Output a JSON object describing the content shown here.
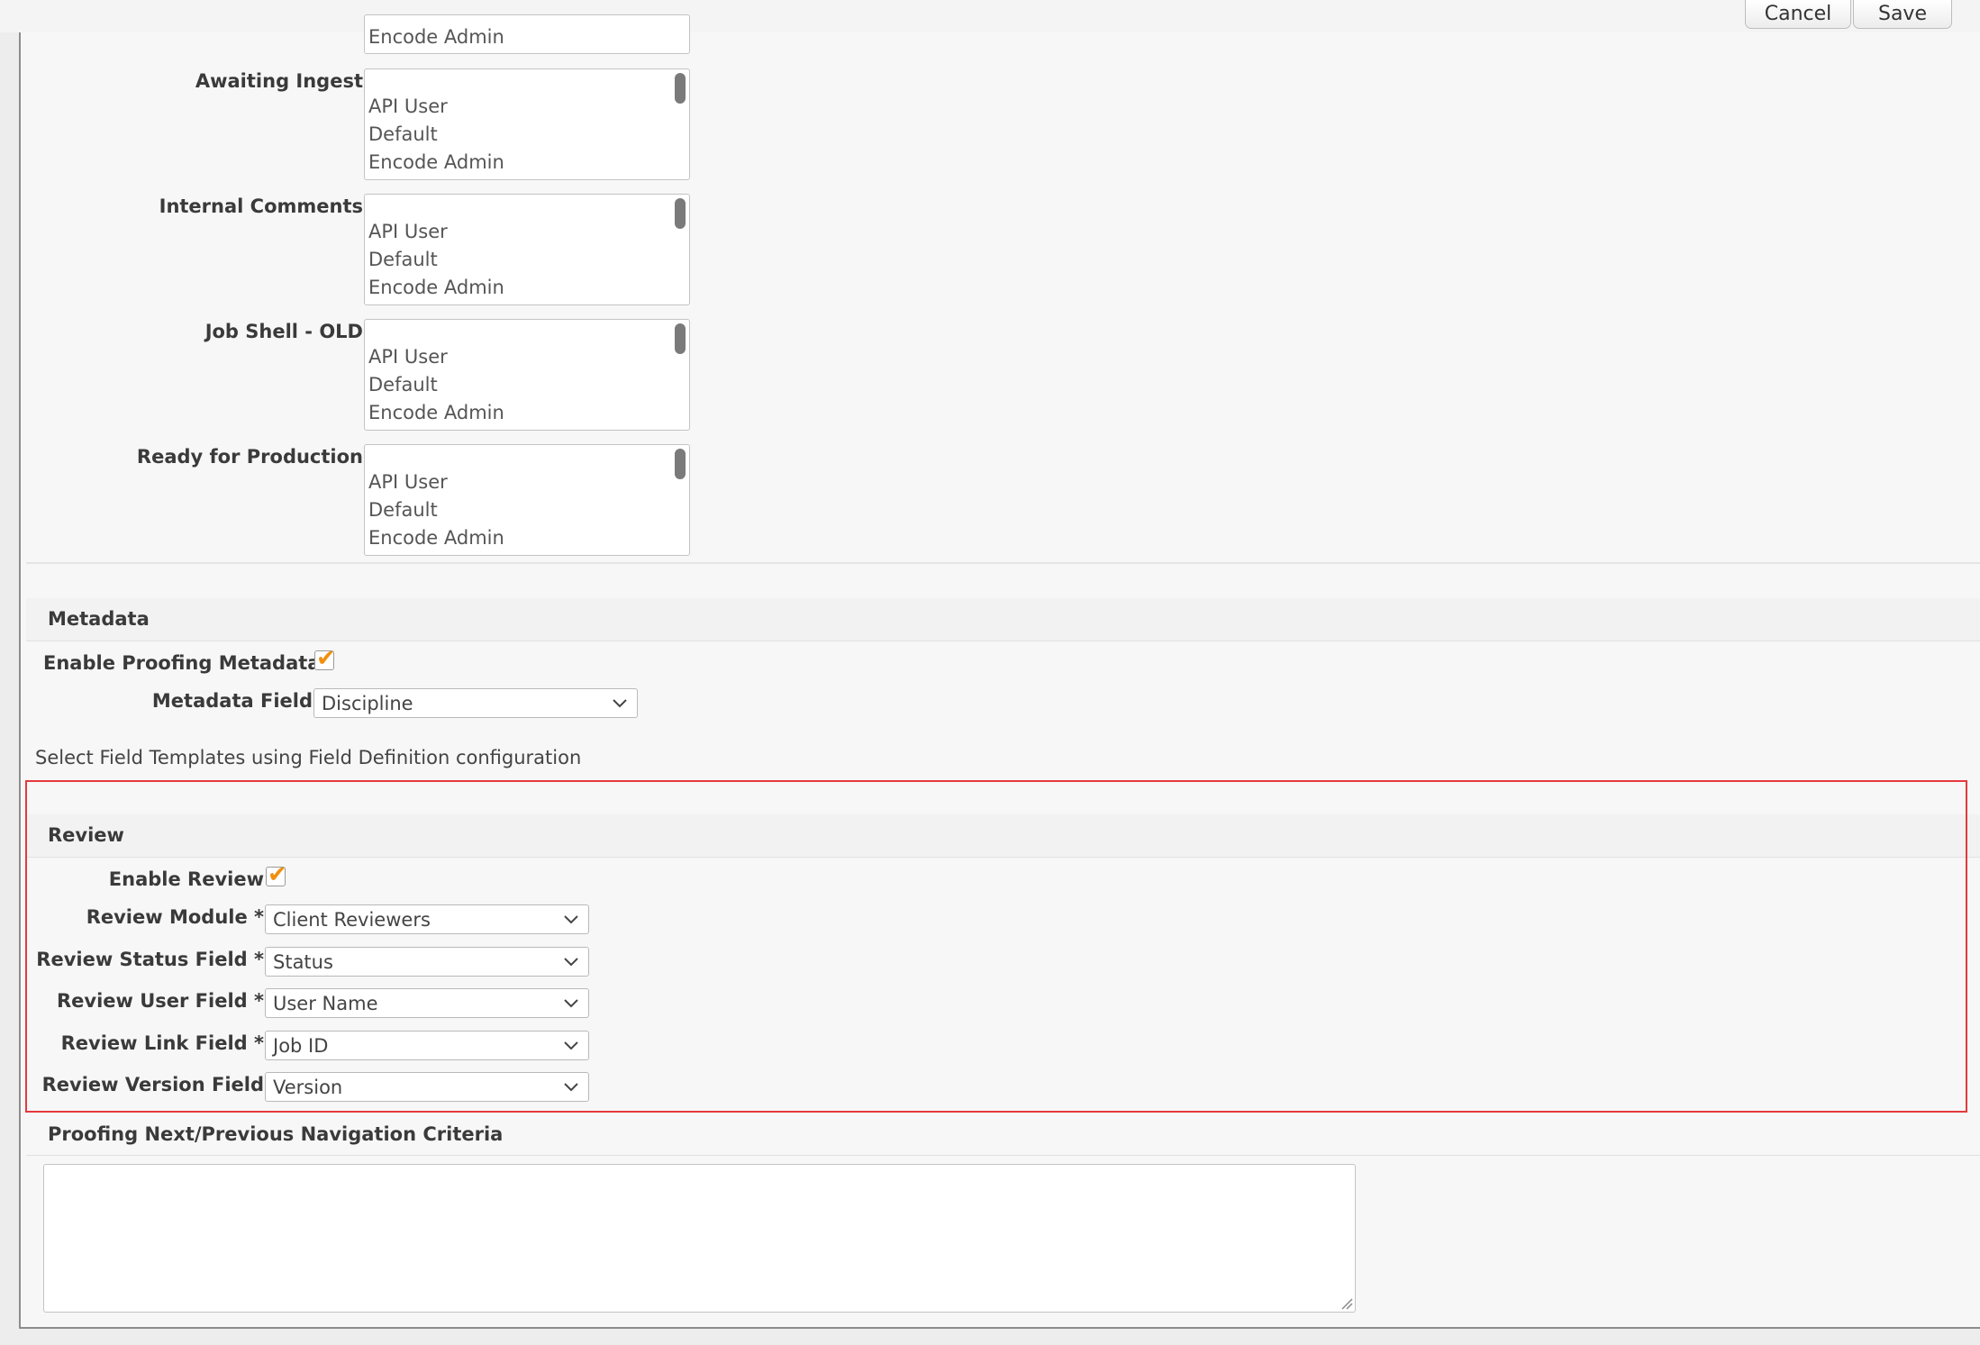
{
  "toolbar": {
    "cancel_label": "Cancel",
    "save_label": "Save"
  },
  "status_lists": {
    "top_partial": {
      "visible_option": "Encode Admin"
    },
    "items": [
      {
        "label": "Awaiting Ingest",
        "options": [
          "API User",
          "Default",
          "Encode Admin"
        ]
      },
      {
        "label": "Internal Comments",
        "options": [
          "API User",
          "Default",
          "Encode Admin"
        ]
      },
      {
        "label": "Job Shell - OLD",
        "options": [
          "API User",
          "Default",
          "Encode Admin"
        ]
      },
      {
        "label": "Ready for Production",
        "options": [
          "API User",
          "Default",
          "Encode Admin"
        ]
      }
    ]
  },
  "metadata": {
    "section_title": "Metadata",
    "enable_label": "Enable Proofing Metadata",
    "enable_checked": true,
    "field_label": "Metadata Field",
    "field_value": "Discipline",
    "note": "Select Field Templates using Field Definition configuration"
  },
  "review": {
    "section_title": "Review",
    "enable_label": "Enable Review",
    "enable_checked": true,
    "fields": [
      {
        "label": "Review Module *",
        "value": "Client Reviewers"
      },
      {
        "label": "Review Status Field *",
        "value": "Status"
      },
      {
        "label": "Review User Field *",
        "value": "User Name"
      },
      {
        "label": "Review Link Field *",
        "value": "Job ID"
      },
      {
        "label": "Review Version Field",
        "value": "Version"
      }
    ]
  },
  "navigation": {
    "section_title": "Proofing Next/Previous Navigation Criteria",
    "criteria_value": ""
  },
  "colors": {
    "checkmark": "#f0900f",
    "highlight_border": "#e5393e"
  },
  "icons": {
    "check": "checkmark-icon",
    "select": "chevron-down-icon",
    "resize": "resize-handle-icon"
  }
}
